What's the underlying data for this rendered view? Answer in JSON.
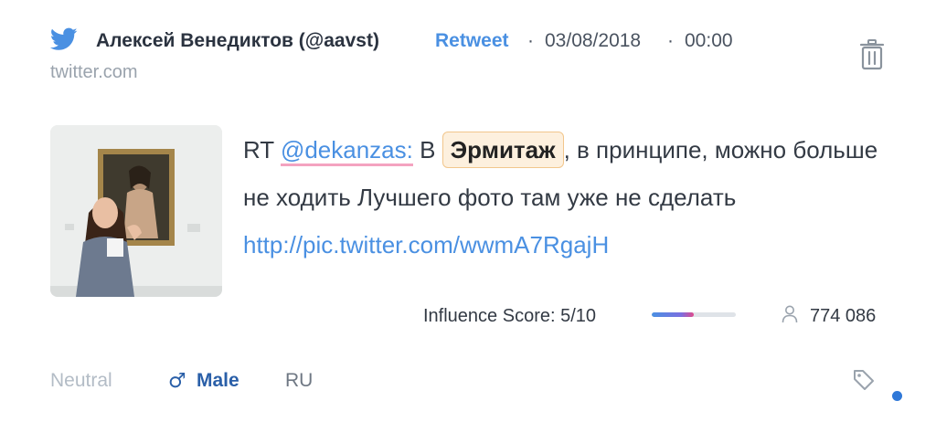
{
  "post": {
    "author": "Алексей Венедиктов (@aavst)",
    "type": "Retweet",
    "separator": "·",
    "date": "03/08/2018",
    "time": "00:00",
    "source": "twitter.com"
  },
  "content": {
    "prefix": "RT ",
    "mention": "@dekanzas:",
    "pre_keyword": " В ",
    "keyword": "Эрмитаж",
    "body": ", в принципе, можно больше не ходить Лучшего фото там уже не сделать ",
    "link": "http://pic.twitter.com/wwmA7RgajH"
  },
  "metrics": {
    "influence_label": "Influence Score: 5/10",
    "influence_score": 5,
    "influence_max": 10,
    "followers": "774 086"
  },
  "meta": {
    "sentiment": "Neutral",
    "gender_icon": "♂",
    "gender": "Male",
    "language": "RU"
  },
  "icons": {
    "brand": "twitter-bird-icon",
    "delete": "trash-icon",
    "followers": "person-icon",
    "tag": "tag-icon"
  },
  "colors": {
    "accent": "#4a90e2",
    "mention_underline": "#f4a3c0",
    "keyword_bg": "#fdf0de",
    "keyword_border": "#f2c68c",
    "gender": "#2a5fa8",
    "status_dot": "#2f78d8"
  }
}
